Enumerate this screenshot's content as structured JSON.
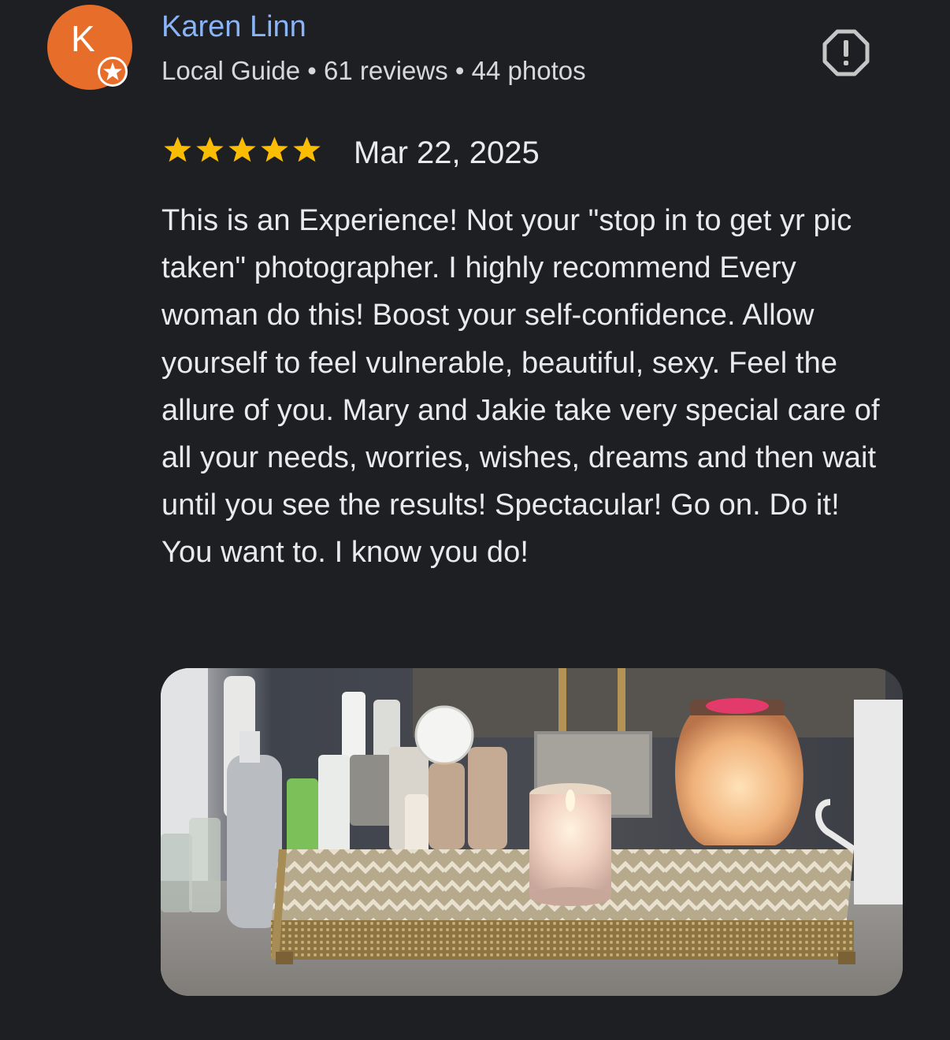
{
  "reviewer": {
    "avatar_letter": "K",
    "name": "Karen Linn",
    "meta": "Local Guide • 61 reviews • 44 photos"
  },
  "review": {
    "rating": 5,
    "max_rating": 5,
    "date": "Mar 22, 2025",
    "text": "This is an Experience! Not your \"stop in to get yr pic taken\" photographer. I highly recommend Every woman do this! Boost your self-confidence. Allow yourself to feel vulnerable, beautiful, sexy. Feel the allure of you. Mary and Jakie take very special care of all your needs, worries, wishes, dreams and then wait until you see the results! Spectacular! Go on. Do it! You want to. I know you do!"
  },
  "icons": {
    "report": "report-flag-icon",
    "star": "star-icon",
    "local_guide": "local-guide-star-icon"
  },
  "colors": {
    "background": "#1e1f23",
    "name_link": "#8ab4f8",
    "star": "#fbbc04",
    "avatar": "#e66d2a"
  }
}
